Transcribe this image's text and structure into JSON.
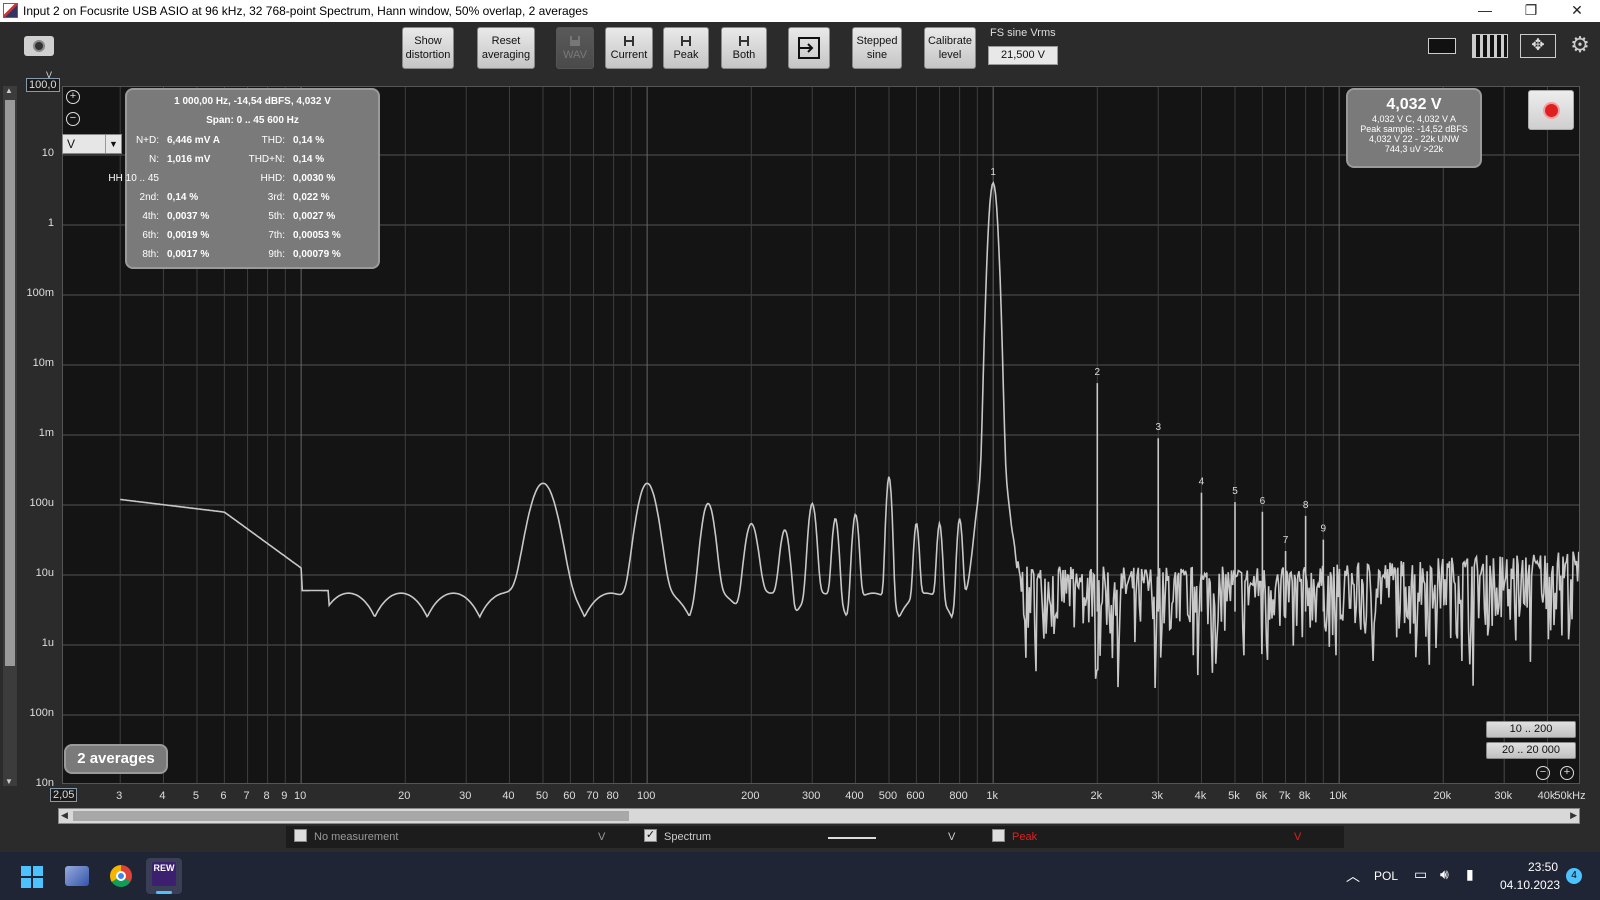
{
  "window": {
    "title": "Input 2 on Focusrite USB ASIO at 96 kHz, 32 768-point Spectrum, Hann window, 50% overlap, 2 averages",
    "minimize": "—",
    "maximize": "❐",
    "close": "✕"
  },
  "toolbar": {
    "show_distortion": [
      "Show",
      "distortion"
    ],
    "reset_averaging": [
      "Reset",
      "averaging"
    ],
    "wav": "WAV",
    "current": "Current",
    "peak": "Peak",
    "both": "Both",
    "stepped_sine": [
      "Stepped",
      "sine"
    ],
    "calibrate_level": [
      "Calibrate",
      "level"
    ],
    "fs_label": "FS sine Vrms",
    "fs_value": "21,500 V",
    "icons": [
      "camera-icon",
      "save-icon",
      "export-icon",
      "display-mode-icon",
      "columns-icon",
      "expand-icon",
      "gear-icon"
    ]
  },
  "plot": {
    "top_value": "100,0",
    "top_unit": "V",
    "y_labels": [
      "10",
      "1",
      "100m",
      "10m",
      "1m",
      "100u",
      "10u",
      "1u",
      "100n",
      "10n"
    ],
    "x_labels": [
      "2,05",
      "3",
      "4",
      "5",
      "6",
      "7",
      "8",
      "9",
      "10",
      "20",
      "30",
      "40",
      "50",
      "60",
      "70",
      "80",
      "100",
      "200",
      "300",
      "400",
      "500",
      "600",
      "800",
      "1k",
      "2k",
      "3k",
      "4k",
      "5k",
      "6k",
      "7k",
      "8k",
      "10k",
      "20k",
      "30k",
      "40k",
      "50kHz"
    ],
    "harmonic_markers": [
      "1",
      "2",
      "3",
      "4",
      "5",
      "6",
      "7",
      "8",
      "9"
    ],
    "unit_select": "V",
    "line_color": "#c8c8c8"
  },
  "info_panel": {
    "header": "1 000,00 Hz, -14,54 dBFS, 4,032 V",
    "span": "Span: 0 .. 45 600 Hz",
    "rows": [
      {
        "l_label": "N+D:",
        "l_value": "6,446 mV A",
        "r_label": "THD:",
        "r_value": "0,14 %"
      },
      {
        "l_label": "N:",
        "l_value": "1,016 mV",
        "r_label": "THD+N:",
        "r_value": "0,14 %"
      },
      {
        "l_label": "HH 10 .. 45",
        "l_value": "",
        "r_label": "HHD:",
        "r_value": "0,0030 %"
      },
      {
        "l_label": "2nd:",
        "l_value": "0,14 %",
        "r_label": "3rd:",
        "r_value": "0,022 %"
      },
      {
        "l_label": "4th:",
        "l_value": "0,0037 %",
        "r_label": "5th:",
        "r_value": "0,0027 %"
      },
      {
        "l_label": "6th:",
        "l_value": "0,0019 %",
        "r_label": "7th:",
        "r_value": "0,00053 %"
      },
      {
        "l_label": "8th:",
        "l_value": "0,0017 %",
        "r_label": "9th:",
        "r_value": "0,00079 %"
      }
    ]
  },
  "readout": {
    "value": "4,032 V",
    "line1": "4,032 V C, 4,032 V A",
    "line2": "Peak sample: -14,52 dBFS",
    "line3": "4,032 V 22 - 22k UNW",
    "line4": "744,3 uV >22k"
  },
  "averages_badge": "2 averages",
  "range_buttons": [
    "10 .. 200",
    "20 .. 20 000"
  ],
  "legend": {
    "no_measurement": "No measurement",
    "no_measurement_unit": "V",
    "spectrum": "Spectrum",
    "spectrum_unit": "V",
    "peak": "Peak",
    "peak_unit": "V",
    "peak_color": "#e02020"
  },
  "taskbar": {
    "language": "POL",
    "time": "23:50",
    "date": "04.10.2023",
    "notifications": "4",
    "rew_label": "REW",
    "icons": [
      "windows-start-icon",
      "photos-icon",
      "chrome-icon",
      "rew-icon",
      "chevron-up-icon",
      "network-icon",
      "volume-icon",
      "battery-icon"
    ]
  }
}
